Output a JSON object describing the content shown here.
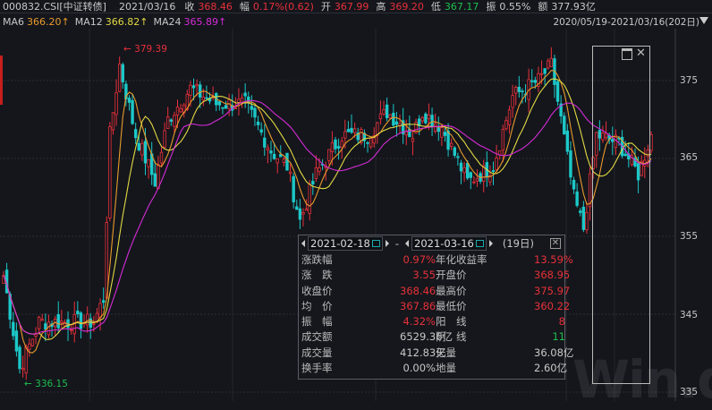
{
  "header": {
    "code": "000832.CSI[中证转债]",
    "date": "2021/03/16",
    "close_label": "收",
    "close": "368.46",
    "change_label": "幅",
    "change": "0.17%(0.62)",
    "open_label": "开",
    "open": "367.99",
    "high_label": "高",
    "high": "369.20",
    "low_label": "低",
    "low": "367.17",
    "amp_label": "振",
    "amp": "0.55%",
    "amount_label": "额",
    "amount": "377.93亿"
  },
  "ma": {
    "ma6_label": "MA6",
    "ma6": "366.20↑",
    "ma12_label": "MA12",
    "ma12": "366.82↑",
    "ma24_label": "MA24",
    "ma24": "365.89↑"
  },
  "range": "2020/05/19-2021/03/16(202日)",
  "axis": {
    "ticks": [
      "375",
      "365",
      "355",
      "345",
      "335"
    ]
  },
  "annotations": {
    "high": "379.39",
    "low": "336.15"
  },
  "watermark": "Win.d",
  "tooltip": {
    "start": "2021-02-18",
    "end": "2021-03-16",
    "sep": "-",
    "days": "(19日)",
    "rows": [
      {
        "l1": "涨跌幅",
        "v1": "0.97%",
        "c1": "red",
        "l2": "年化收益率",
        "v2": "13.59%",
        "c2": "red"
      },
      {
        "l1": "涨　跌",
        "v1": "3.55",
        "c1": "red",
        "l2": "开盘价",
        "v2": "368.95",
        "c2": "red"
      },
      {
        "l1": "收盘价",
        "v1": "368.46",
        "c1": "red",
        "l2": "最高价",
        "v2": "375.97",
        "c2": "red"
      },
      {
        "l1": "均　价",
        "v1": "367.86",
        "c1": "red",
        "l2": "最低价",
        "v2": "360.22",
        "c2": "red"
      },
      {
        "l1": "振　幅",
        "v1": "4.32%",
        "c1": "red",
        "l2": "阳　线",
        "v2": "8",
        "c2": "red"
      },
      {
        "l1": "成交额",
        "v1": "6529.36亿",
        "c1": "",
        "l2": "阴　线",
        "v2": "11",
        "c2": "grn"
      },
      {
        "l1": "成交量",
        "v1": "412.83亿",
        "c1": "",
        "l2": "天量",
        "v2": "36.08亿",
        "c2": ""
      },
      {
        "l1": "换手率",
        "v1": "0.00%",
        "c1": "",
        "l2": "地量",
        "v2": "2.60亿",
        "c2": ""
      }
    ]
  },
  "colors": {
    "up": "#e8303a",
    "down": "#1cc8c8",
    "ma6": "#e99a2c",
    "ma12": "#e3d942",
    "ma24": "#d52bd5"
  },
  "chart_data": {
    "type": "candlestick",
    "days": 202,
    "ylim": [
      335,
      380
    ],
    "close_keypoints": [
      [
        0,
        350
      ],
      [
        5,
        338
      ],
      [
        11,
        344
      ],
      [
        28,
        344
      ],
      [
        31,
        347
      ],
      [
        33,
        368
      ],
      [
        36,
        377
      ],
      [
        41,
        368
      ],
      [
        47,
        362
      ],
      [
        51,
        370
      ],
      [
        58,
        374
      ],
      [
        66,
        372
      ],
      [
        75,
        372
      ],
      [
        83,
        366
      ],
      [
        88,
        364
      ],
      [
        92,
        357
      ],
      [
        97,
        363
      ],
      [
        105,
        368
      ],
      [
        113,
        368
      ],
      [
        119,
        371
      ],
      [
        127,
        368
      ],
      [
        130,
        371
      ],
      [
        136,
        369
      ],
      [
        144,
        362
      ],
      [
        152,
        364
      ],
      [
        158,
        373
      ],
      [
        166,
        375
      ],
      [
        170,
        377
      ],
      [
        173,
        370
      ],
      [
        177,
        360
      ],
      [
        180,
        356
      ],
      [
        184,
        368
      ],
      [
        191,
        367
      ],
      [
        197,
        363
      ],
      [
        201,
        368
      ]
    ]
  }
}
